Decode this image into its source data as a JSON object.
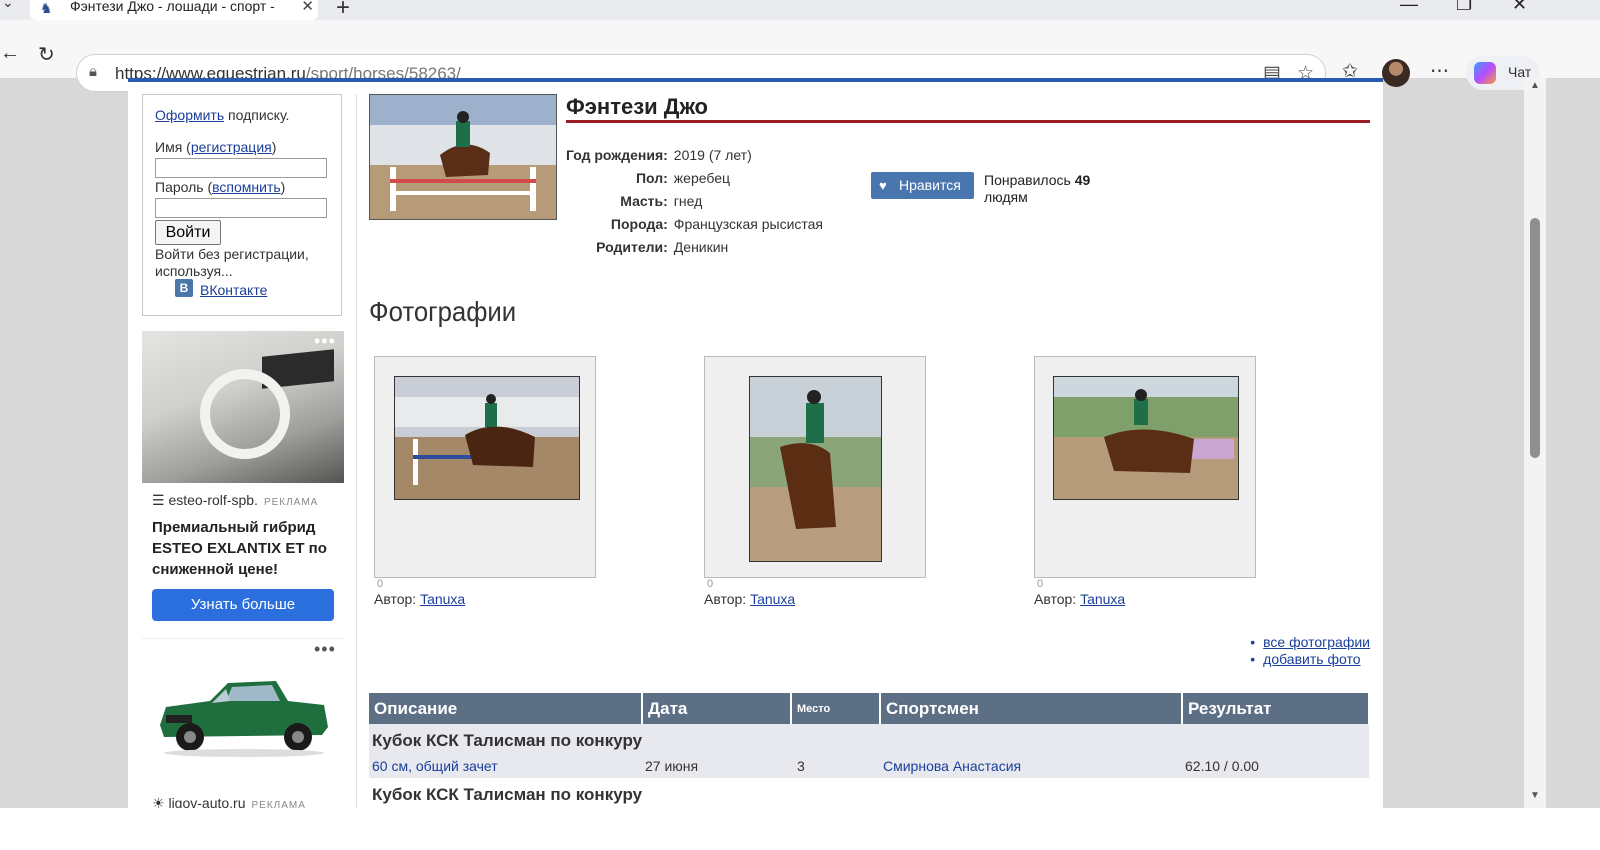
{
  "browser": {
    "tab_title": "Фэнтези Джо - лошади - спорт - ",
    "url_host": "https://www.equestrian.ru",
    "url_path": "/sport/horses/58263/",
    "copilot_label": "Чат"
  },
  "login": {
    "subscribe_link": "Оформить",
    "subscribe_text": " подписку.",
    "name_label": "Имя (",
    "register_link": "регистрация",
    "close_paren": ")",
    "password_label": "Пароль (",
    "remind_link": "вспомнить",
    "login_button": "Войти",
    "no_reg_text": "Войти без регистрации, используя...",
    "vk_link": "ВКонтакте"
  },
  "ads": [
    {
      "source": "esteo-rolf-spb.",
      "tag": "РЕКЛАМА",
      "headline": "Премиальный гибрид ESTEO EXLANTIX ET по сниженной цене!",
      "cta": "Узнать больше"
    },
    {
      "source": "ligov-auto.ru",
      "tag": "РЕКЛАМА"
    }
  ],
  "horse": {
    "name": "Фэнтези Джо",
    "info": [
      {
        "label": "Год рождения:",
        "value": "2019 (7 лет)"
      },
      {
        "label": "Пол:",
        "value": "жеребец"
      },
      {
        "label": "Масть:",
        "value": "гнед"
      },
      {
        "label": "Порода:",
        "value": "Французская рысистая"
      },
      {
        "label": "Родители:",
        "value": "Деникин"
      }
    ],
    "like_button": "Нравится",
    "liked_prefix": "Понравилось ",
    "liked_count": "49",
    "liked_suffix": "людям"
  },
  "photos": {
    "heading": "Фотографии",
    "items": [
      {
        "count": "0",
        "author_label": "Автор: ",
        "author": "Tanuxa"
      },
      {
        "count": "0",
        "author_label": "Автор: ",
        "author": "Tanuxa"
      },
      {
        "count": "0",
        "author_label": "Автор: ",
        "author": "Tanuxa"
      }
    ],
    "all_photos_link": "все фотографии",
    "add_photo_link": "добавить фото"
  },
  "results": {
    "headers": [
      "Описание",
      "Дата",
      "Место",
      "Спортсмен",
      "Результат"
    ],
    "events": [
      {
        "title": "Кубок КСК Талисман по конкуру",
        "class": "60 см, общий зачет",
        "date": "27 июня",
        "place": "3",
        "rider": "Смирнова Анастасия",
        "result": "62.10 / 0.00"
      },
      {
        "title": "Кубок КСК Талисман по конкуру"
      }
    ]
  },
  "colors": {
    "accent_blue": "#2a5bb0",
    "name_underline": "#9c1c24",
    "table_header": "#5d6f85",
    "like_button": "#4a76b0",
    "ad_cta": "#2b6fde"
  }
}
